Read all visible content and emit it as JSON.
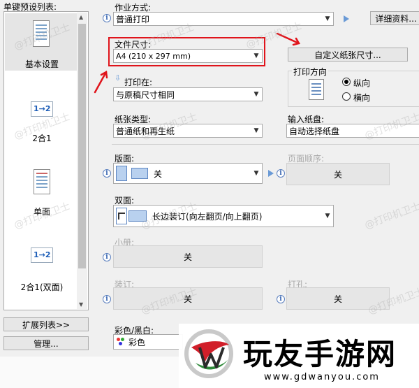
{
  "left": {
    "title": "单键预设列表:",
    "presets": [
      {
        "label": "基本设置",
        "icon": "document-icon",
        "selected": true
      },
      {
        "label": "2合1",
        "icon": "two-in-one-icon",
        "badge": "1→2"
      },
      {
        "label": "单面",
        "icon": "document-icon"
      },
      {
        "label": "2合1(双面)",
        "icon": "two-in-one-duplex-icon",
        "badge": "1→2"
      }
    ],
    "expand_button": "扩展列表>>",
    "manage_button": "管理..."
  },
  "job": {
    "label": "作业方式:",
    "value": "普通打印",
    "details_button": "详细资料..."
  },
  "paper_size": {
    "label": "文件尺寸:",
    "value": "A4 (210 x 297 mm)",
    "custom_button": "自定义纸张尺寸..."
  },
  "print_on": {
    "label": "打印在:",
    "value": "与原稿尺寸相同"
  },
  "orientation": {
    "label": "打印方向",
    "options": [
      "纵向",
      "横向"
    ],
    "selected": "纵向"
  },
  "paper_type": {
    "label": "纸张类型:",
    "value": "普通纸和再生纸"
  },
  "input_tray": {
    "label": "输入纸盘:",
    "value": "自动选择纸盘"
  },
  "layout": {
    "label": "版面:",
    "value": "关"
  },
  "page_order": {
    "label": "页面顺序:",
    "value": "关"
  },
  "duplex": {
    "label": "双面:",
    "value": "长边装订(向左翻页/向上翻页)"
  },
  "booklet": {
    "label": "小册:",
    "value": "关"
  },
  "binding": {
    "label": "装订:",
    "value": "关"
  },
  "punch": {
    "label": "打孔:",
    "value": "关"
  },
  "color": {
    "label": "彩色/黑白:",
    "value": "彩色"
  },
  "brand": {
    "name": "玩友手游网",
    "url": "www.gdwanyou.com"
  },
  "watermark": "@打印机卫士",
  "colors": {
    "highlight_red": "#e0141b",
    "brand_red": "#d11f2a",
    "brand_green": "#2f8a3a"
  }
}
